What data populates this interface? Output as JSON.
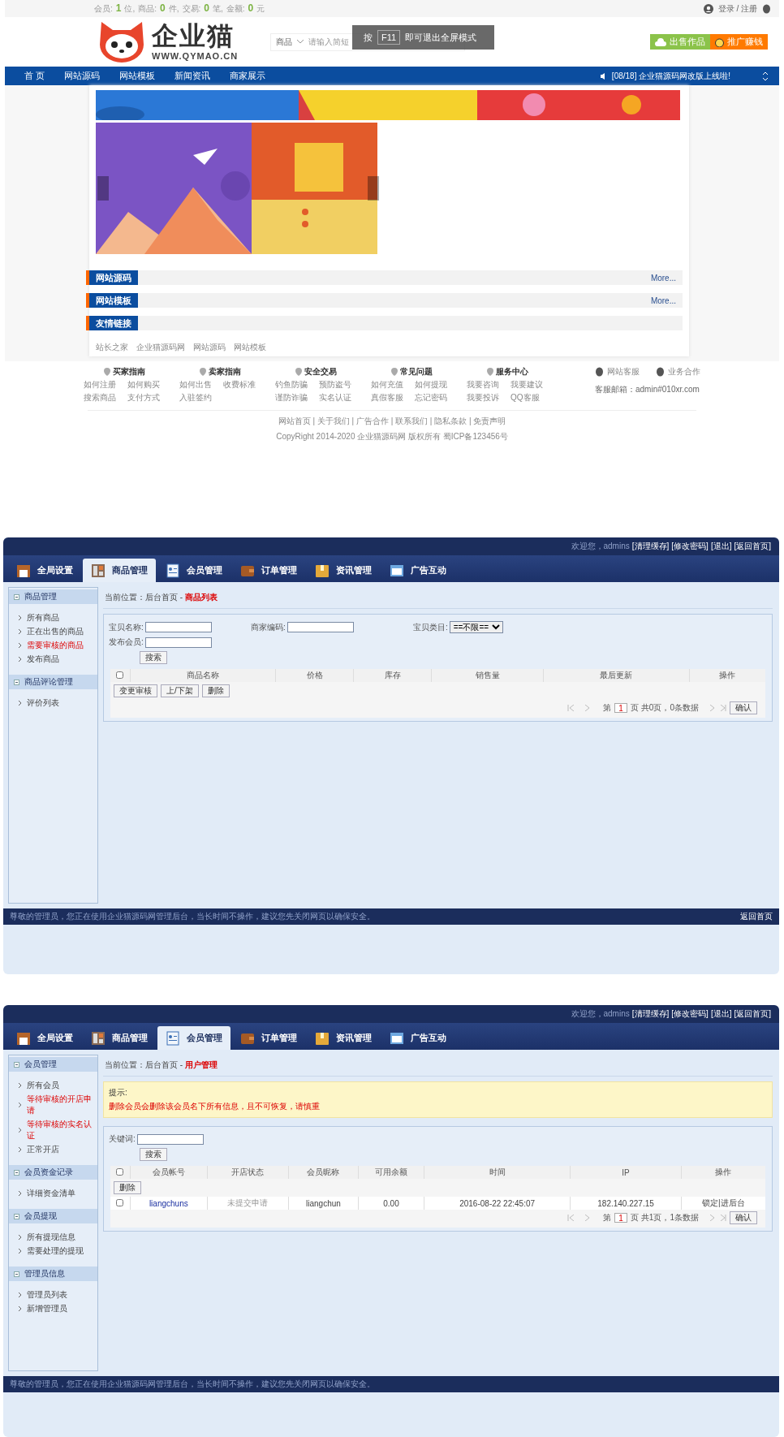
{
  "site": {
    "stats": [
      {
        "label": "会员:",
        "value": "1",
        "unit": "位,"
      },
      {
        "label": "商品:",
        "value": "0",
        "unit": "件,"
      },
      {
        "label": "交易:",
        "value": "0",
        "unit": "笔,"
      },
      {
        "label": "金额:",
        "value": "0",
        "unit": "元"
      }
    ],
    "account": "登录 / 注册",
    "logo": {
      "name": "企业猫",
      "url": "WWW.QYMAO.CN"
    },
    "search": {
      "category": "商品",
      "placeholder": "请输入简短"
    },
    "fullscreen_tip": {
      "before": "按",
      "key": "F11",
      "after": "即可退出全屏模式"
    },
    "actions": [
      {
        "label": "出售作品",
        "kind": "upload"
      },
      {
        "label": "推广赚钱",
        "kind": "money"
      }
    ],
    "nav": [
      "首 页",
      "网站源码",
      "网站模板",
      "新闻资讯",
      "商家展示"
    ],
    "notice": "[08/18] 企业猫源码网改版上线啦!",
    "sections": [
      {
        "title": "网站源码",
        "more": "More..."
      },
      {
        "title": "网站模板",
        "more": "More..."
      },
      {
        "title": "友情链接"
      }
    ],
    "friend_links": [
      "站长之家",
      "企业猫源码网",
      "网站源码",
      "网站模板"
    ],
    "footer_columns": [
      {
        "title": "买家指南",
        "links": [
          "如何注册",
          "如何购买",
          "搜索商品",
          "支付方式"
        ]
      },
      {
        "title": "卖家指南",
        "links": [
          "如何出售",
          "收费标准",
          "入驻签约"
        ]
      },
      {
        "title": "安全交易",
        "links": [
          "钓鱼防骗",
          "预防盗号",
          "谨防诈骗",
          "实名认证"
        ]
      },
      {
        "title": "常见问题",
        "links": [
          "如何充值",
          "如何提现",
          "真假客服",
          "忘记密码"
        ]
      },
      {
        "title": "服务中心",
        "links": [
          "我要咨询",
          "我要建议",
          "我要投诉",
          "QQ客服"
        ]
      }
    ],
    "contacts": [
      "网站客服",
      "业务合作"
    ],
    "email": "客服邮箱：admin#010xr.com",
    "footer_links": "网站首页 | 关于我们 | 广告合作 | 联系我们 | 隐私条款 | 免责声明",
    "copyright": "CopyRight 2014-2020 企业猫源码网 版权所有 蜀ICP备123456号"
  },
  "admin_pages": [
    {
      "welcome": "欢迎您，admins",
      "top_links": [
        "[清理缓存]",
        "[修改密码]",
        "[退出]",
        "[返回首页]"
      ],
      "tabs": [
        {
          "label": "全局设置",
          "kind": "cabinet",
          "selected": false
        },
        {
          "label": "商品管理",
          "kind": "grid",
          "selected": true
        },
        {
          "label": "会员管理",
          "kind": "card",
          "selected": false
        },
        {
          "label": "订单管理",
          "kind": "wallet",
          "selected": false
        },
        {
          "label": "资讯管理",
          "kind": "folder",
          "selected": false
        },
        {
          "label": "广告互动",
          "kind": "window",
          "selected": false
        }
      ],
      "sidebar": [
        {
          "title": "商品管理",
          "items": [
            {
              "label": "所有商品",
              "alert": false
            },
            {
              "label": "正在出售的商品",
              "alert": false
            },
            {
              "label": "需要审核的商品",
              "alert": true
            },
            {
              "label": "发布商品",
              "alert": false
            }
          ]
        },
        {
          "title": "商品评论管理",
          "items": [
            {
              "label": "评价列表",
              "alert": false
            }
          ]
        }
      ],
      "breadcrumb": {
        "prefix": "当前位置：后台首页 - ",
        "current": "商品列表"
      },
      "filters": [
        {
          "label": "宝贝名称:",
          "kind": "input"
        },
        {
          "label": "商家编码:",
          "kind": "input"
        },
        {
          "label": "宝贝类目:",
          "kind": "select",
          "value": "==不限=="
        },
        {
          "label": "发布会员:",
          "kind": "input"
        }
      ],
      "search_button": "搜索",
      "select_all": {
        "checked": false
      },
      "columns": [
        "商品名称",
        "价格",
        "库存",
        "销售量",
        "最后更新",
        "操作"
      ],
      "actions": [
        "变更审核",
        "上/下架",
        "删除"
      ],
      "pagination": {
        "before": "第",
        "page": "1",
        "after": "页  共0页，0条数据",
        "confirm": "确认"
      },
      "footer": {
        "message": "尊敬的管理员，您正在使用企业猫源码网管理后台，当长时间不操作，建议您先关闭网页以确保安全。",
        "link": "返回首页"
      }
    },
    {
      "welcome": "欢迎您，admins",
      "top_links": [
        "[清理缓存]",
        "[修改密码]",
        "[退出]",
        "[返回首页]"
      ],
      "tabs": [
        {
          "label": "全局设置",
          "kind": "cabinet",
          "selected": false
        },
        {
          "label": "商品管理",
          "kind": "grid",
          "selected": false
        },
        {
          "label": "会员管理",
          "kind": "card",
          "selected": true
        },
        {
          "label": "订单管理",
          "kind": "wallet",
          "selected": false
        },
        {
          "label": "资讯管理",
          "kind": "folder",
          "selected": false
        },
        {
          "label": "广告互动",
          "kind": "window",
          "selected": false
        }
      ],
      "sidebar": [
        {
          "title": "会员管理",
          "items": [
            {
              "label": "所有会员",
              "alert": false
            },
            {
              "label": "等待审核的开店申请",
              "alert": true
            },
            {
              "label": "等待审核的实名认证",
              "alert": true
            },
            {
              "label": "正常开店",
              "alert": false
            }
          ]
        },
        {
          "title": "会员资金记录",
          "items": [
            {
              "label": "详细资金清单",
              "alert": false
            }
          ]
        },
        {
          "title": "会员提现",
          "items": [
            {
              "label": "所有提现信息",
              "alert": false
            },
            {
              "label": "需要处理的提现",
              "alert": false
            }
          ]
        },
        {
          "title": "管理员信息",
          "items": [
            {
              "label": "管理员列表",
              "alert": false
            },
            {
              "label": "新增管理员",
              "alert": false
            }
          ]
        }
      ],
      "breadcrumb": {
        "prefix": "当前位置：后台首页 - ",
        "current": "用户管理"
      },
      "notice": {
        "title": "提示:",
        "text": "删除会员会删除该会员名下所有信息，且不可恢复，请慎重"
      },
      "filters": [
        {
          "label": "关键词:",
          "kind": "input"
        }
      ],
      "search_button": "搜索",
      "select_all": {
        "checked": false
      },
      "columns": [
        "会员帐号",
        "开店状态",
        "会员昵称",
        "可用余额",
        "时间",
        "IP",
        "操作"
      ],
      "actions": [
        "删除"
      ],
      "rows": [
        {
          "checked": false,
          "cells": [
            {
              "text": "liangchuns",
              "kind": "link"
            },
            {
              "text": "未提交申请",
              "kind": "muted"
            },
            {
              "text": "liangchun",
              "kind": "text"
            },
            {
              "text": "0.00",
              "kind": "text"
            },
            {
              "text": "2016-08-22 22:45:07",
              "kind": "text"
            },
            {
              "text": "182.140.227.15",
              "kind": "text"
            },
            {
              "text": "锁定|进后台",
              "kind": "text"
            }
          ]
        }
      ],
      "pagination": {
        "before": "第",
        "page": "1",
        "after": "页  共1页，1条数据",
        "confirm": "确认"
      },
      "footer": {
        "message": "尊敬的管理员，您正在使用企业猫源码网管理后台，当长时间不操作，建议您先关闭网页以确保安全。"
      }
    }
  ]
}
